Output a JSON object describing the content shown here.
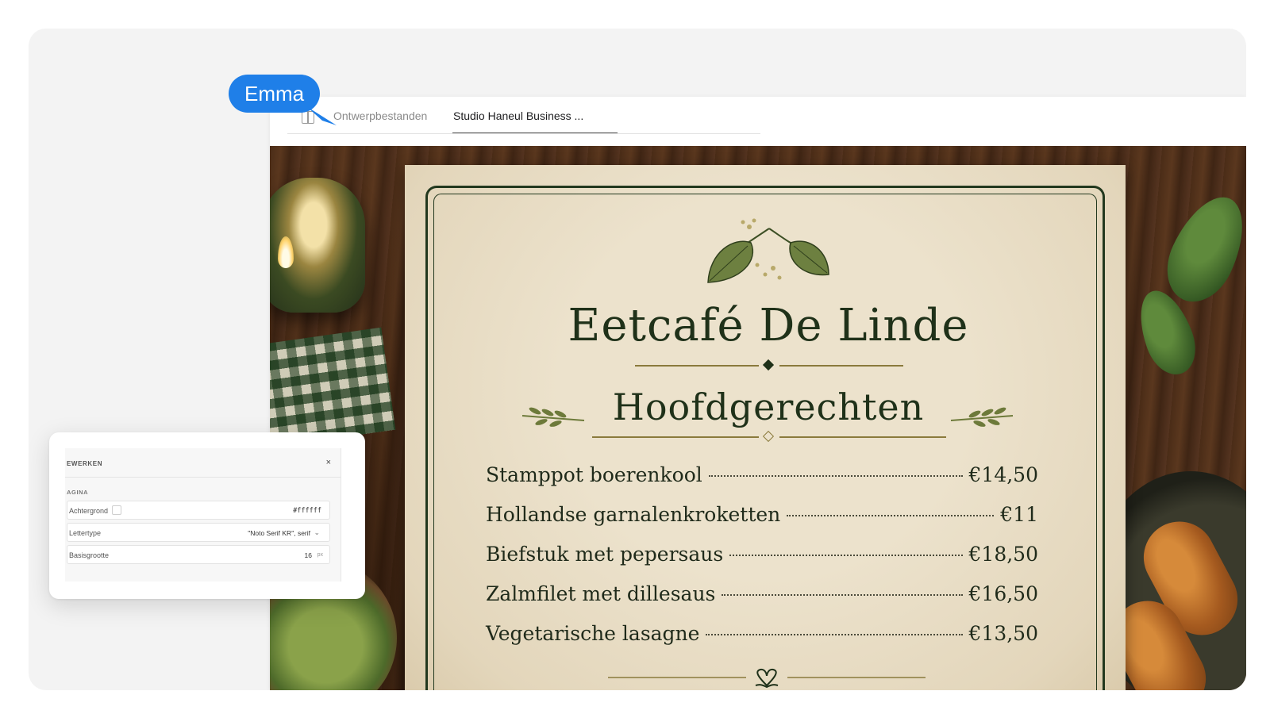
{
  "collaborator": {
    "name": "Emma",
    "color": "#1f7fe8"
  },
  "tabs": [
    {
      "label": "Ontwerpbestanden",
      "active": false
    },
    {
      "label": "Studio Haneul Business ...",
      "active": true
    }
  ],
  "menu": {
    "title": "Eetcafé De Linde",
    "section": "Hoofdgerechten",
    "items": [
      {
        "name": "Stamppot boerenkool",
        "price": "€14,50"
      },
      {
        "name": "Hollandse garnalenkroketten",
        "price": "€11"
      },
      {
        "name": "Biefstuk met pepersaus",
        "price": "€18,50"
      },
      {
        "name": "Zalmfilet met dillesaus",
        "price": "€16,50"
      },
      {
        "name": "Vegetarische lasagne",
        "price": "€13,50"
      }
    ],
    "colors": {
      "ink": "#1f3119",
      "paper": "#e8dcc3",
      "gold": "#8a7a3c"
    }
  },
  "panel": {
    "title": "EWERKEN",
    "close_label": "×",
    "section": "AGINA",
    "background": {
      "label": "Achtergrond",
      "value": "#ffffff"
    },
    "font": {
      "label": "Lettertype",
      "value": "\"Noto Serif KR\", serif"
    },
    "base_size": {
      "label": "Basisgrootte",
      "value": "16",
      "unit": "px"
    }
  }
}
